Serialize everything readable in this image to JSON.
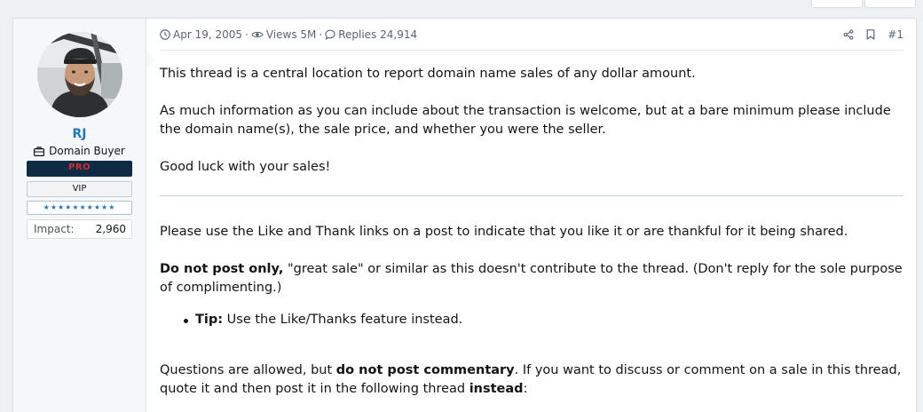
{
  "post": {
    "date": "Apr 19, 2005",
    "views": "Views 5M",
    "replies": "Replies 24,914",
    "number": "#1"
  },
  "user": {
    "name": "RJ",
    "title": "Domain Buyer",
    "banner_pro": "PRO",
    "banner_vip": "VIP",
    "banner_stars": "★★★★★★★★★★",
    "impact_label": "Impact:",
    "impact_value": "2,960"
  },
  "content": {
    "p1": "This thread is a central location to report domain name sales of any dollar amount.",
    "p2": "As much information as you can include about the transaction is welcome, but at a bare minimum please include the domain name(s), the sale price, and whether you were the seller.",
    "p3": "Good luck with your sales!",
    "p4": "Please use the Like and Thank links on a post to indicate that you like it or are thankful for it being shared.",
    "p5_bold": "Do not post only,",
    "p5_rest": " \"great sale\" or similar as this doesn't contribute to the thread. (Don't reply for the sole purpose of complimenting.)",
    "tip_bold": "Tip:",
    "tip_rest": " Use the Like/Thanks feature instead.",
    "p6_a": "Questions are allowed, but ",
    "p6_bold": "do not post commentary",
    "p6_b": ". If you want to discuss or comment on a sale in this thread, quote it and then post it in the following thread ",
    "p6_bold2": "instead",
    "p6_c": ":"
  },
  "icons": {
    "clock": "clock-icon",
    "eye": "eye-icon",
    "comment": "comment-icon",
    "share": "share-icon",
    "bookmark": "bookmark-icon",
    "briefcase": "briefcase-icon"
  }
}
